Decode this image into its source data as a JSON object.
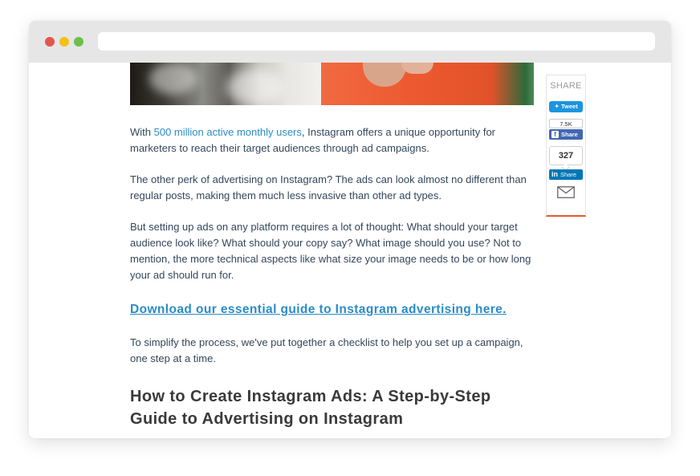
{
  "window": {
    "url": ""
  },
  "share": {
    "title": "SHARE",
    "tweet_label": "Tweet",
    "fb_count": "7.5K",
    "fb_label": "Share",
    "li_count": "327",
    "li_label": "Share",
    "li_logo": "in",
    "tweet_icon": "twitter-bird-icon",
    "fb_icon": "facebook-f-icon",
    "email_icon": "envelope-icon"
  },
  "article": {
    "p1_prefix": "With ",
    "p1_link": "500 million active monthly users",
    "p1_suffix": ", Instagram offers a unique opportunity for marketers to reach their target audiences through ad campaigns.",
    "p2": "The other perk of advertising on Instagram? The ads can look almost no different than regular posts, making them much less invasive than other ad types.",
    "p3": "But setting up ads on any platform requires a lot of thought: What should your target audience look like? What should your copy say? What image should you use? Not to mention, the more technical aspects like what size your image needs to be or how long your ad should run for.",
    "cta": "Download our essential guide to Instagram advertising here.",
    "p4": "To simplify the process, we've put together a checklist to help you set up a campaign, one step at a time.",
    "heading": "How to Create Instagram Ads: A Step-by-Step Guide to Advertising on Instagram"
  },
  "colors": {
    "link": "#2a8cc8",
    "twitter": "#1b95e0",
    "facebook": "#4267b2",
    "linkedin": "#0077b5",
    "accent": "#e25b2e"
  }
}
